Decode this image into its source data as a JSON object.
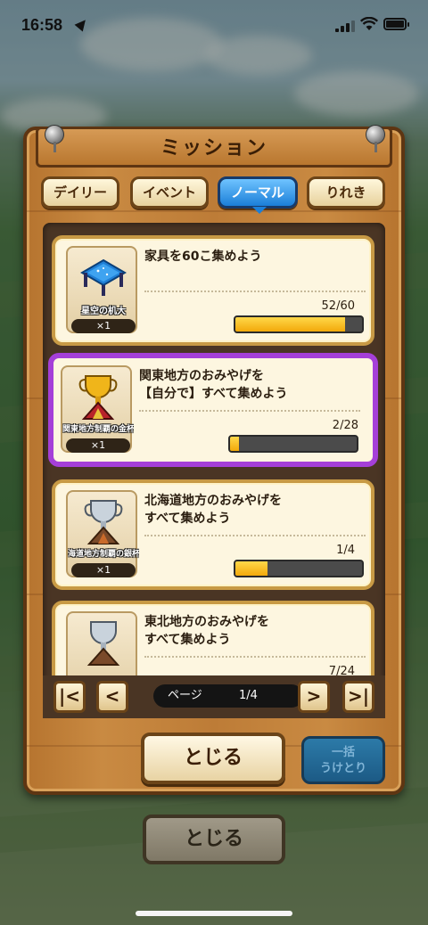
{
  "status_bar": {
    "time": "16:58"
  },
  "panel": {
    "title": "ミッション"
  },
  "tabs": [
    {
      "label": "デイリー",
      "active": false
    },
    {
      "label": "イベント",
      "active": false
    },
    {
      "label": "ノーマル",
      "active": true
    },
    {
      "label": "りれき",
      "active": false
    }
  ],
  "missions": [
    {
      "item_name": "星空の机大",
      "item_count": "×1",
      "text": "家具を60こ集めよう",
      "progress": "52/60",
      "progress_fraction": 0.867
    },
    {
      "item_name": "関東地方制覇の金杯",
      "item_count": "×1",
      "text": "関東地方のおみやげを\n【自分で】すべて集めよう",
      "progress": "2/28",
      "progress_fraction": 0.071,
      "highlighted": true
    },
    {
      "item_name": "海道地方制覇の銀杯",
      "item_count": "×1",
      "text": "北海道地方のおみやげを\nすべて集めよう",
      "progress": "1/4",
      "progress_fraction": 0.25
    },
    {
      "item_name": "",
      "item_count": "",
      "text": "東北地方のおみやげを\nすべて集めよう",
      "progress": "7/24",
      "progress_fraction": 0.29
    }
  ],
  "pager": {
    "label": "ページ",
    "page": "1/4"
  },
  "buttons": {
    "close": "とじる",
    "collect_line1": "一括",
    "collect_line2": "うけとり",
    "close_bg": "とじる"
  },
  "colors": {
    "active_tab": "#1b7fd8",
    "highlight": "#a53fd8",
    "bar_fill": "#f2a90a",
    "wood": "#c98a42"
  }
}
